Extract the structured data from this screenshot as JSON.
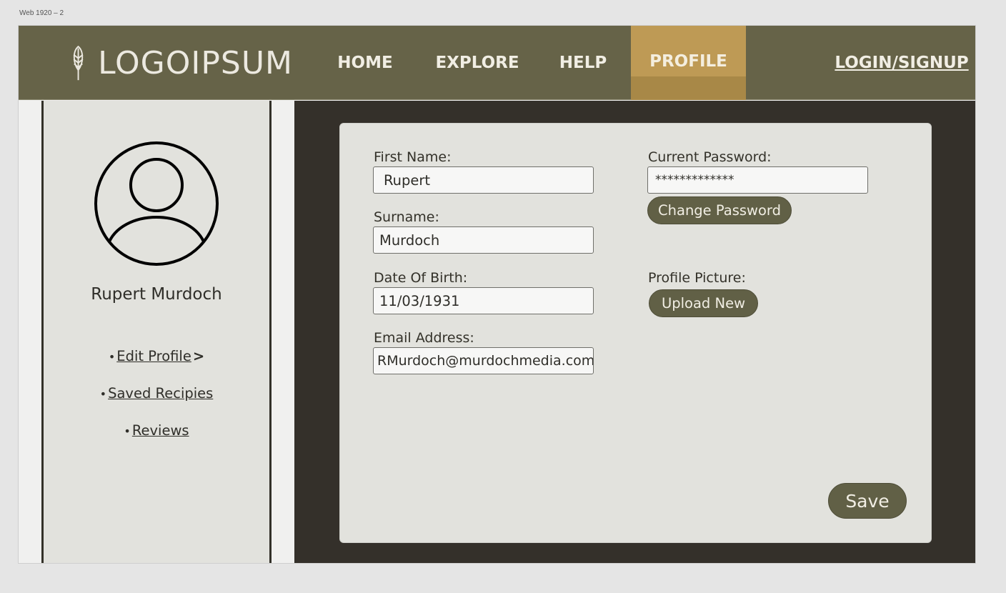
{
  "frame": {
    "label": "Web 1920 – 2"
  },
  "brand": {
    "logo_text": "LOGOIPSUM"
  },
  "nav": {
    "home": "HOME",
    "explore": "EXPLORE",
    "help": "HELP",
    "profile": "PROFILE",
    "login": "LOGIN/SIGNUP",
    "active_color": "#be9a55",
    "bar_color": "#666348"
  },
  "sidebar": {
    "user_name": "Rupert Murdoch",
    "links": [
      {
        "bullet": "•",
        "label": "Edit Profile",
        "chevron": ">"
      },
      {
        "bullet": "•",
        "label": "Saved Recipies"
      },
      {
        "bullet": "•",
        "label": "Reviews"
      }
    ]
  },
  "form": {
    "first_name_label": "First Name:",
    "first_name_value": "Rupert",
    "surname_label": "Surname:",
    "surname_value": "Murdoch",
    "dob_label": "Date Of Birth:",
    "dob_value": "11/03/1931",
    "email_label": "Email Address:",
    "email_value": "RMurdoch@murdochmedia.com",
    "password_label": "Current Password:",
    "password_value": "*************",
    "change_password_button": "Change Password",
    "profile_picture_label": "Profile Picture:",
    "upload_button": "Upload New",
    "save_button": "Save"
  }
}
